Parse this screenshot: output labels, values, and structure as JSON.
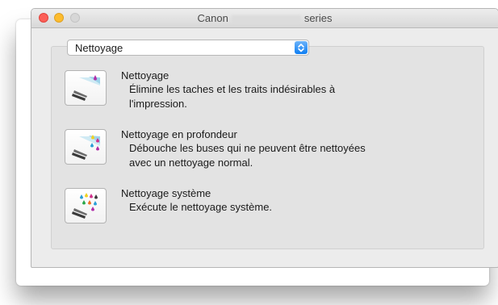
{
  "window": {
    "title_prefix": "Canon",
    "title_suffix": "series"
  },
  "popup": {
    "selected": "Nettoyage"
  },
  "items": [
    {
      "title": "Nettoyage",
      "desc_line1": "Élimine les taches et les traits indésirables à",
      "desc_line2": "l'impression.",
      "icon": "cleaning-icon"
    },
    {
      "title": "Nettoyage en profondeur",
      "desc_line1": "Débouche les buses qui ne peuvent être nettoyées",
      "desc_line2": "avec un nettoyage normal.",
      "icon": "deep-cleaning-icon"
    },
    {
      "title": "Nettoyage système",
      "desc_line1": "Exécute le nettoyage système.",
      "desc_line2": "",
      "icon": "system-cleaning-icon"
    }
  ],
  "colors": {
    "close": "#fc5f57",
    "minimize": "#fdbc2e",
    "zoom": "#d7d7d7",
    "accent": "#0f7ef2"
  }
}
